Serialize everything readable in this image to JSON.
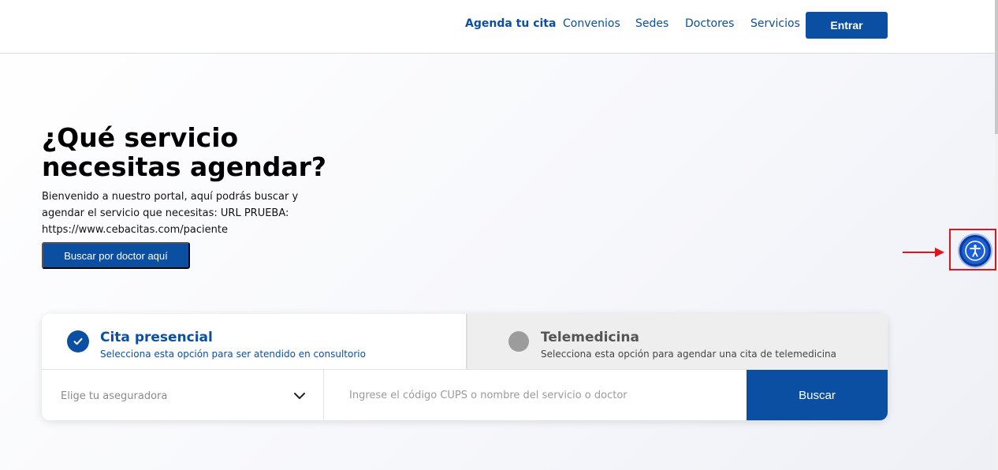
{
  "nav": {
    "items": [
      {
        "label": "Agenda tu cita"
      },
      {
        "label": "Convenios"
      },
      {
        "label": "Sedes"
      },
      {
        "label": "Doctores"
      },
      {
        "label": "Servicios"
      }
    ],
    "login_label": "Entrar"
  },
  "hero": {
    "title_line1": "¿Qué servicio",
    "title_line2": "necesitas agendar?",
    "text": "Bienvenido a nuestro portal, aquí podrás buscar y agendar el servicio que necesitas: URL PRUEBA: https://www.cebacitas.com/paciente",
    "doctor_button_label": "Buscar por doctor aquí"
  },
  "search_panel": {
    "tabs": [
      {
        "title": "Cita presencial",
        "subtitle": "Selecciona esta opción para ser atendido en consultorio",
        "selected": true
      },
      {
        "title": "Telemedicina",
        "subtitle": "Selecciona esta opción para agendar una cita de telemedicina",
        "selected": false
      }
    ],
    "insurer_select": {
      "label": "Elige tu aseguradora"
    },
    "search_input": {
      "placeholder": "Ingrese el código CUPS o nombre del servicio o doctor",
      "value": ""
    },
    "search_button_label": "Buscar"
  },
  "accessibility": {
    "icon": "accessibility-icon"
  },
  "colors": {
    "primary": "#0b4fa3",
    "highlight": "#e0141b",
    "accessibility": "#1a5fd6"
  }
}
